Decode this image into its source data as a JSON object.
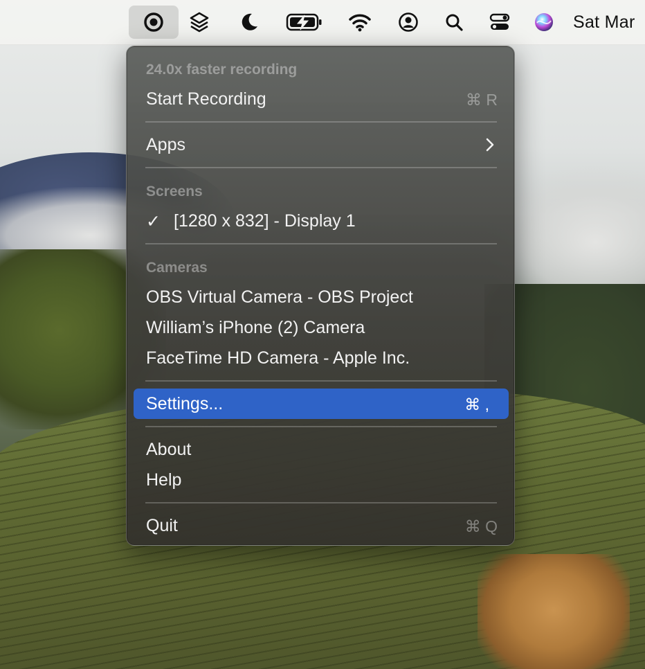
{
  "menubar": {
    "icons": [
      "record-app-icon",
      "layers-icon",
      "moon-icon",
      "battery-charging-icon",
      "wifi-icon",
      "user-account-icon",
      "search-icon",
      "control-center-icon",
      "siri-icon"
    ],
    "clock": "Sat Mar"
  },
  "menu": {
    "header_speed": "24.0x faster recording",
    "start_recording": {
      "label": "Start Recording",
      "shortcut": "⌘ R"
    },
    "apps": {
      "label": "Apps",
      "icon": "chevron-right-icon"
    },
    "screens_header": "Screens",
    "screens": [
      {
        "label": "[1280 x 832] - Display 1",
        "checked": true,
        "check": "✓"
      }
    ],
    "cameras_header": "Cameras",
    "cameras": [
      {
        "label": "OBS Virtual Camera - OBS Project"
      },
      {
        "label": "William’s iPhone (2) Camera"
      },
      {
        "label": "FaceTime HD Camera - Apple Inc."
      }
    ],
    "settings": {
      "label": "Settings...",
      "shortcut": "⌘ ,",
      "highlighted": true
    },
    "about": {
      "label": "About"
    },
    "help": {
      "label": "Help"
    },
    "quit": {
      "label": "Quit",
      "shortcut": "⌘ Q"
    }
  },
  "colors": {
    "highlight": "#2f63c7",
    "menu_text": "#f2f2f2",
    "menu_disabled": "#8c8c8c"
  }
}
